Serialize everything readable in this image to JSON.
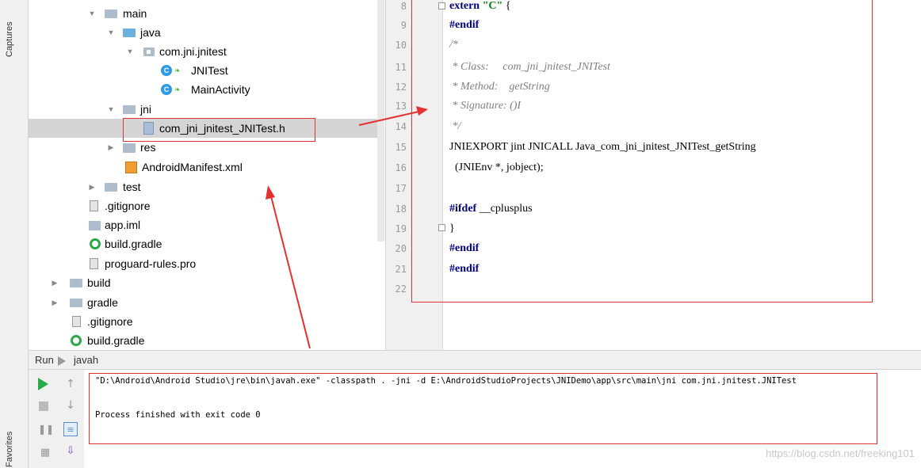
{
  "sidebar": {
    "captures_label": "Captures",
    "favorites_label": "Favorites"
  },
  "tree": {
    "items": [
      {
        "label": "main",
        "icon": "folder-icon"
      },
      {
        "label": "java",
        "icon": "folder-icon"
      },
      {
        "label": "com.jni.jnitest",
        "icon": "package-icon"
      },
      {
        "label": "JNITest",
        "icon": "class-icon"
      },
      {
        "label": "MainActivity",
        "icon": "class-icon"
      },
      {
        "label": "jni",
        "icon": "folder-icon"
      },
      {
        "label": "com_jni_jnitest_JNITest.h",
        "icon": "header-file-icon"
      },
      {
        "label": "res",
        "icon": "resource-folder-icon"
      },
      {
        "label": "AndroidManifest.xml",
        "icon": "xml-file-icon"
      },
      {
        "label": "test",
        "icon": "folder-icon"
      },
      {
        "label": ".gitignore",
        "icon": "text-file-icon"
      },
      {
        "label": "app.iml",
        "icon": "iml-file-icon"
      },
      {
        "label": "build.gradle",
        "icon": "gradle-icon"
      },
      {
        "label": "proguard-rules.pro",
        "icon": "text-file-icon"
      },
      {
        "label": "build",
        "icon": "folder-icon"
      },
      {
        "label": "gradle",
        "icon": "folder-icon"
      },
      {
        "label": ".gitignore",
        "icon": "text-file-icon"
      },
      {
        "label": "build.gradle",
        "icon": "gradle-icon"
      }
    ],
    "class_badge": "C"
  },
  "editor": {
    "line_numbers": [
      "8",
      "9",
      "10",
      "11",
      "12",
      "13",
      "14",
      "15",
      "16",
      "17",
      "18",
      "19",
      "20",
      "21",
      "22"
    ],
    "lines": {
      "l8_kw": "extern",
      "l8_str": "\"C\"",
      "l8_rest": " {",
      "l9": "#endif",
      "l10": "/*",
      "l11": " * Class:     com_jni_jnitest_JNITest",
      "l12": " * Method:    getString",
      "l13": " * Signature: ()I",
      "l14": " */",
      "l15": "JNIEXPORT jint JNICALL Java_com_jni_jnitest_JNITest_getString",
      "l16": "  (JNIEnv *, jobject);",
      "l17": "",
      "l18_kw": "#ifdef",
      "l18_rest": " __cplusplus",
      "l19": "}",
      "l20": "#endif",
      "l21": "#endif",
      "l22": ""
    }
  },
  "run": {
    "tab_label": "Run",
    "config_label": "javah",
    "console_lines": [
      "\"D:\\Android\\Android Studio\\jre\\bin\\javah.exe\" -classpath . -jni -d E:\\AndroidStudioProjects\\JNIDemo\\app\\src\\main\\jni com.jni.jnitest.JNITest",
      "Process finished with exit code 0"
    ]
  },
  "watermark": "https://blog.csdn.net/freeking101",
  "colors": {
    "annotation_red": "#e53030",
    "keyword": "#000080",
    "string": "#008000",
    "comment": "#808080",
    "run_green": "#2aa84a"
  }
}
